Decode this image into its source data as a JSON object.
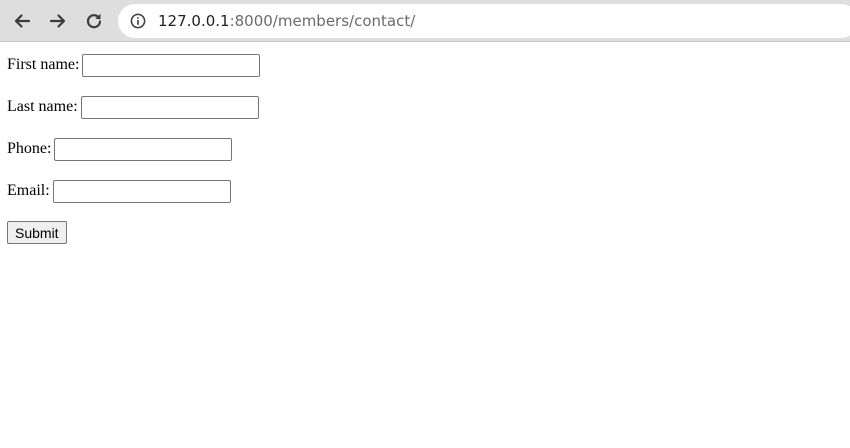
{
  "browser": {
    "nav_icons": {
      "back": "arrow-left",
      "forward": "arrow-right",
      "reload": "reload"
    },
    "address_bar": {
      "icon": "info-circle",
      "host": "127.0.0.1",
      "rest": ":8000/members/contact/"
    }
  },
  "form": {
    "fields": [
      {
        "label": "First name:",
        "value": ""
      },
      {
        "label": "Last name:",
        "value": ""
      },
      {
        "label": "Phone:",
        "value": ""
      },
      {
        "label": "Email:",
        "value": ""
      }
    ],
    "submit_label": "Submit"
  }
}
